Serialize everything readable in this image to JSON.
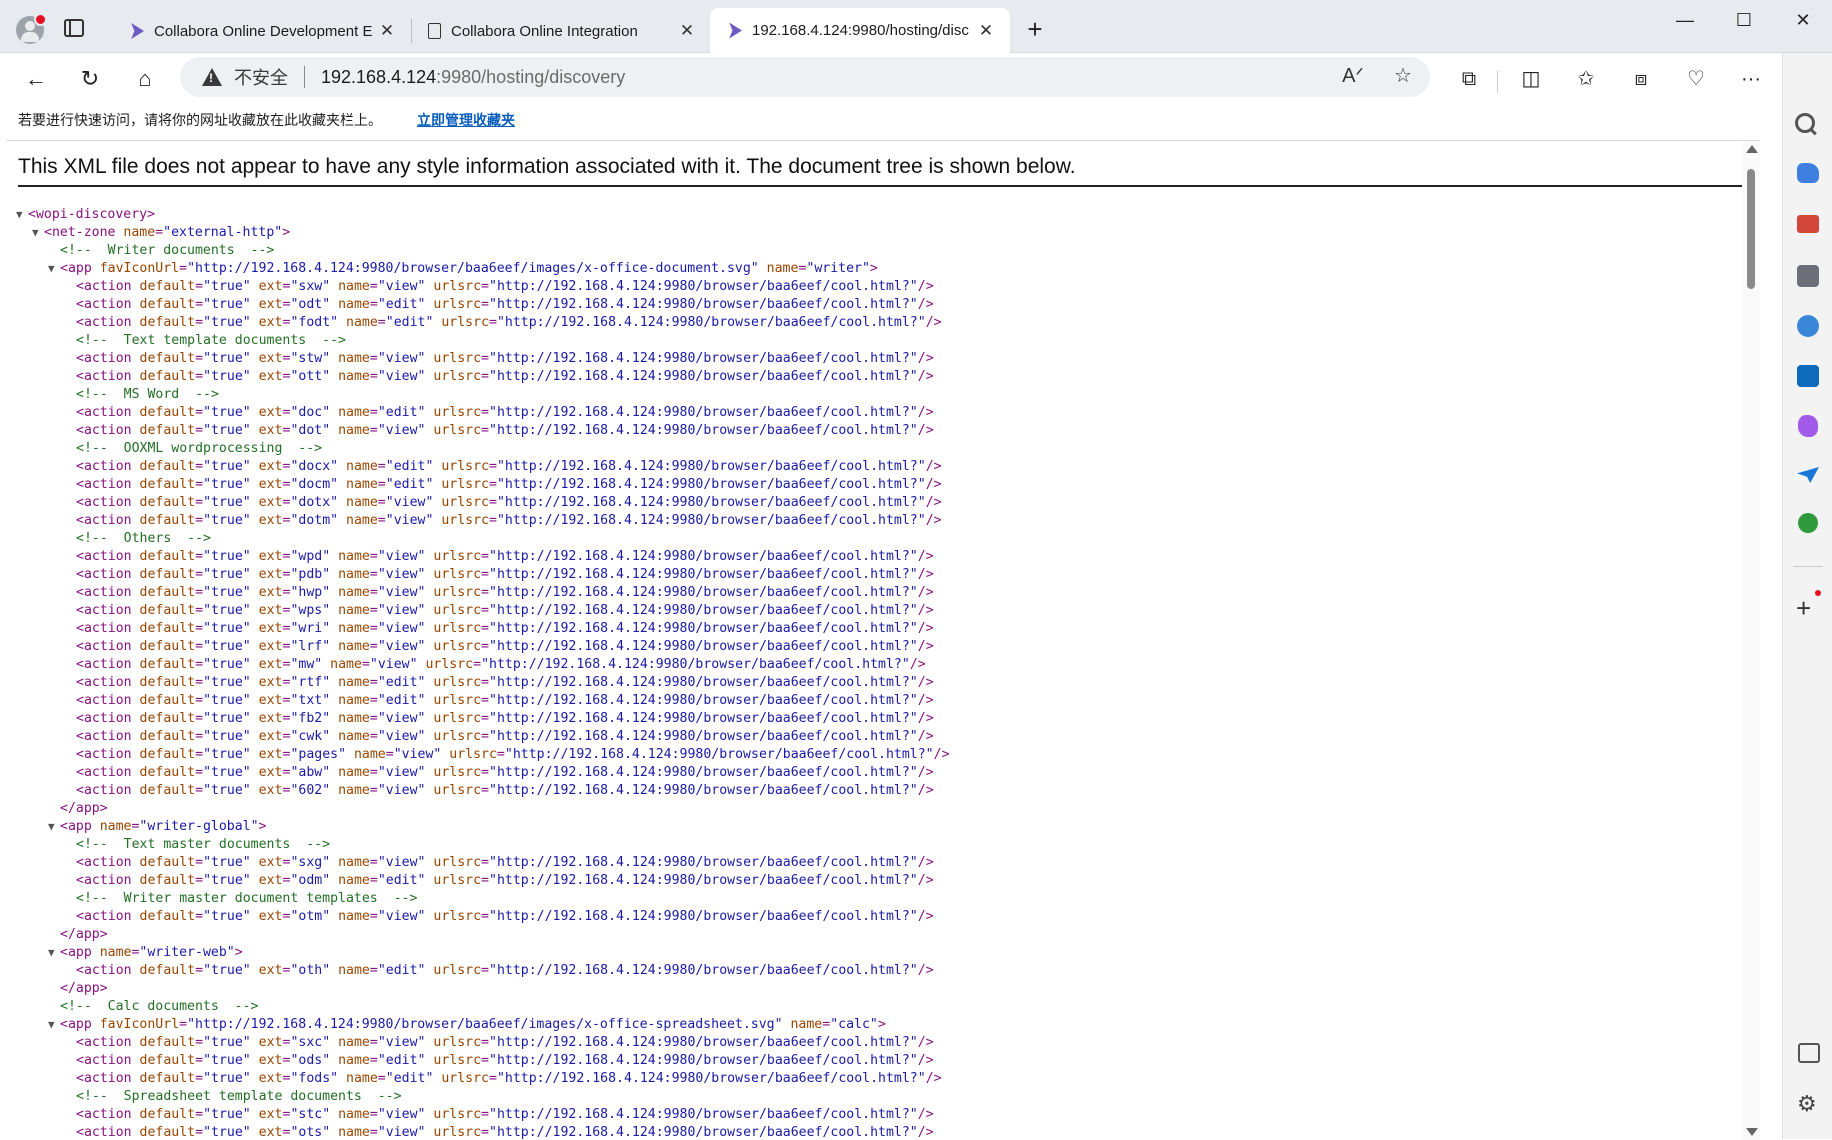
{
  "tabs": [
    {
      "title": "Collabora Online Development E",
      "icon": "collabora-icon",
      "active": false
    },
    {
      "title": "Collabora Online Integration",
      "icon": "page-icon",
      "active": false
    },
    {
      "title": "192.168.4.124:9980/hosting/disc",
      "icon": "collabora-icon",
      "active": true
    }
  ],
  "address": {
    "security_label": "不安全",
    "url_host": "192.168.4.124",
    "url_rest": ":9980/hosting/discovery"
  },
  "favorites_hint": {
    "text": "若要进行快速访问，请将你的网址收藏放在此收藏夹栏上。",
    "link": "立即管理收藏夹"
  },
  "xml_notice": "This XML file does not appear to have any style information associated with it. The document tree is shown below.",
  "colors": {
    "tag": "#881280",
    "attr_name": "#994500",
    "attr_value": "#1a1aa6",
    "comment": "#236e25",
    "link": "#0a5fbd"
  },
  "xml_tree": [
    {
      "indent": 0,
      "toggle": "▼",
      "parts": [
        [
          "t",
          "<wopi-discovery>"
        ]
      ]
    },
    {
      "indent": 1,
      "toggle": "▼",
      "parts": [
        [
          "t",
          "<net-zone "
        ],
        [
          "an",
          "name"
        ],
        [
          "t",
          "="
        ],
        [
          "av",
          "\"external-http\""
        ],
        [
          "t",
          ">"
        ]
      ]
    },
    {
      "indent": 2,
      "toggle": "",
      "parts": [
        [
          "cm",
          "<!--  Writer documents  -->"
        ]
      ]
    },
    {
      "indent": 2,
      "toggle": "▼",
      "parts": [
        [
          "t",
          "<app "
        ],
        [
          "an",
          "favIconUrl"
        ],
        [
          "t",
          "="
        ],
        [
          "av",
          "\"http://192.168.4.124:9980/browser/baa6eef/images/x-office-document.svg\""
        ],
        [
          "t",
          " "
        ],
        [
          "an",
          "name"
        ],
        [
          "t",
          "="
        ],
        [
          "av",
          "\"writer\""
        ],
        [
          "t",
          ">"
        ]
      ]
    },
    {
      "indent": 3,
      "ext": "sxw",
      "name": "view"
    },
    {
      "indent": 3,
      "ext": "odt",
      "name": "edit"
    },
    {
      "indent": 3,
      "ext": "fodt",
      "name": "edit"
    },
    {
      "indent": 3,
      "toggle": "",
      "parts": [
        [
          "cm",
          "<!--  Text template documents  -->"
        ]
      ]
    },
    {
      "indent": 3,
      "ext": "stw",
      "name": "view"
    },
    {
      "indent": 3,
      "ext": "ott",
      "name": "view"
    },
    {
      "indent": 3,
      "toggle": "",
      "parts": [
        [
          "cm",
          "<!--  MS Word  -->"
        ]
      ]
    },
    {
      "indent": 3,
      "ext": "doc",
      "name": "edit"
    },
    {
      "indent": 3,
      "ext": "dot",
      "name": "view"
    },
    {
      "indent": 3,
      "toggle": "",
      "parts": [
        [
          "cm",
          "<!--  OOXML wordprocessing  -->"
        ]
      ]
    },
    {
      "indent": 3,
      "ext": "docx",
      "name": "edit"
    },
    {
      "indent": 3,
      "ext": "docm",
      "name": "edit"
    },
    {
      "indent": 3,
      "ext": "dotx",
      "name": "view"
    },
    {
      "indent": 3,
      "ext": "dotm",
      "name": "view"
    },
    {
      "indent": 3,
      "toggle": "",
      "parts": [
        [
          "cm",
          "<!--  Others  -->"
        ]
      ]
    },
    {
      "indent": 3,
      "ext": "wpd",
      "name": "view"
    },
    {
      "indent": 3,
      "ext": "pdb",
      "name": "view"
    },
    {
      "indent": 3,
      "ext": "hwp",
      "name": "view"
    },
    {
      "indent": 3,
      "ext": "wps",
      "name": "view"
    },
    {
      "indent": 3,
      "ext": "wri",
      "name": "view"
    },
    {
      "indent": 3,
      "ext": "lrf",
      "name": "view"
    },
    {
      "indent": 3,
      "ext": "mw",
      "name": "view"
    },
    {
      "indent": 3,
      "ext": "rtf",
      "name": "edit"
    },
    {
      "indent": 3,
      "ext": "txt",
      "name": "edit"
    },
    {
      "indent": 3,
      "ext": "fb2",
      "name": "view"
    },
    {
      "indent": 3,
      "ext": "cwk",
      "name": "view"
    },
    {
      "indent": 3,
      "ext": "pages",
      "name": "view"
    },
    {
      "indent": 3,
      "ext": "abw",
      "name": "view"
    },
    {
      "indent": 3,
      "ext": "602",
      "name": "view"
    },
    {
      "indent": 2,
      "toggle": "",
      "parts": [
        [
          "t",
          "</app>"
        ]
      ]
    },
    {
      "indent": 2,
      "toggle": "▼",
      "parts": [
        [
          "t",
          "<app "
        ],
        [
          "an",
          "name"
        ],
        [
          "t",
          "="
        ],
        [
          "av",
          "\"writer-global\""
        ],
        [
          "t",
          ">"
        ]
      ]
    },
    {
      "indent": 3,
      "toggle": "",
      "parts": [
        [
          "cm",
          "<!--  Text master documents  -->"
        ]
      ]
    },
    {
      "indent": 3,
      "ext": "sxg",
      "name": "view"
    },
    {
      "indent": 3,
      "ext": "odm",
      "name": "edit"
    },
    {
      "indent": 3,
      "toggle": "",
      "parts": [
        [
          "cm",
          "<!--  Writer master document templates  -->"
        ]
      ]
    },
    {
      "indent": 3,
      "ext": "otm",
      "name": "view"
    },
    {
      "indent": 2,
      "toggle": "",
      "parts": [
        [
          "t",
          "</app>"
        ]
      ]
    },
    {
      "indent": 2,
      "toggle": "▼",
      "parts": [
        [
          "t",
          "<app "
        ],
        [
          "an",
          "name"
        ],
        [
          "t",
          "="
        ],
        [
          "av",
          "\"writer-web\""
        ],
        [
          "t",
          ">"
        ]
      ]
    },
    {
      "indent": 3,
      "ext": "oth",
      "name": "edit"
    },
    {
      "indent": 2,
      "toggle": "",
      "parts": [
        [
          "t",
          "</app>"
        ]
      ]
    },
    {
      "indent": 2,
      "toggle": "",
      "parts": [
        [
          "cm",
          "<!--  Calc documents  -->"
        ]
      ]
    },
    {
      "indent": 2,
      "toggle": "▼",
      "parts": [
        [
          "t",
          "<app "
        ],
        [
          "an",
          "favIconUrl"
        ],
        [
          "t",
          "="
        ],
        [
          "av",
          "\"http://192.168.4.124:9980/browser/baa6eef/images/x-office-spreadsheet.svg\""
        ],
        [
          "t",
          " "
        ],
        [
          "an",
          "name"
        ],
        [
          "t",
          "="
        ],
        [
          "av",
          "\"calc\""
        ],
        [
          "t",
          ">"
        ]
      ]
    },
    {
      "indent": 3,
      "ext": "sxc",
      "name": "view"
    },
    {
      "indent": 3,
      "ext": "ods",
      "name": "edit"
    },
    {
      "indent": 3,
      "ext": "fods",
      "name": "edit"
    },
    {
      "indent": 3,
      "toggle": "",
      "parts": [
        [
          "cm",
          "<!--  Spreadsheet template documents  -->"
        ]
      ]
    },
    {
      "indent": 3,
      "ext": "stc",
      "name": "view"
    },
    {
      "indent": 3,
      "ext": "ots",
      "name": "view"
    }
  ],
  "action_default": "true",
  "action_urlsrc": "http://192.168.4.124:9980/browser/baa6eef/cool.html?"
}
